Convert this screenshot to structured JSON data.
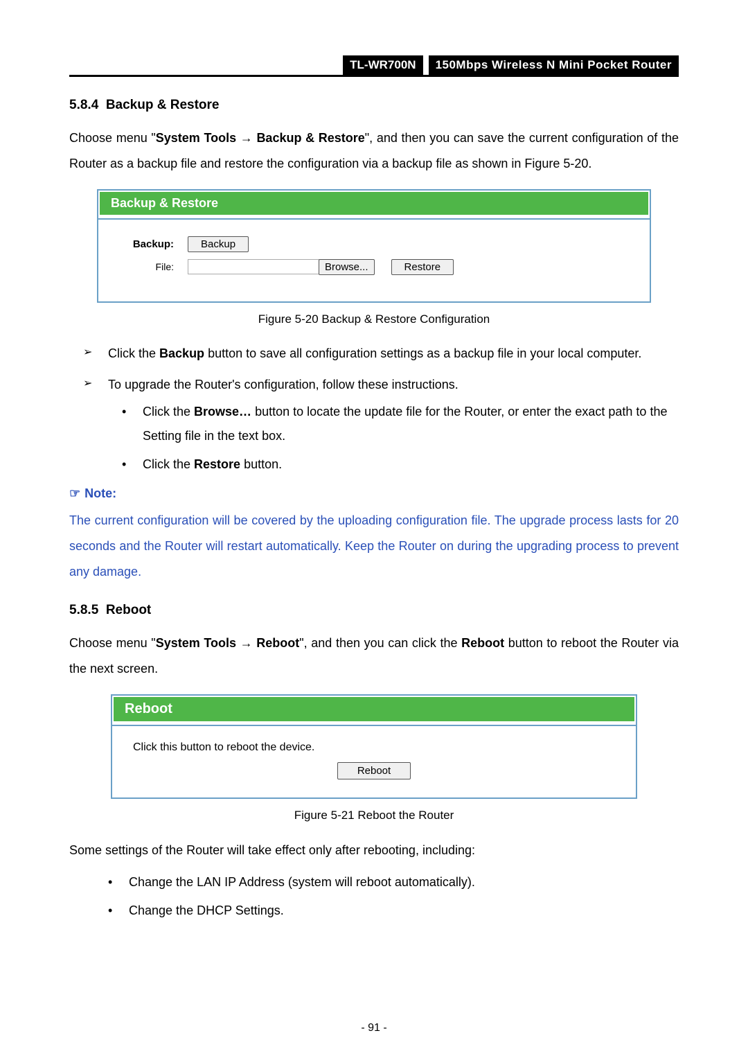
{
  "header": {
    "model": "TL-WR700N",
    "desc": "150Mbps Wireless N Mini Pocket Router"
  },
  "section584": {
    "num": "5.8.4",
    "title": "Backup & Restore",
    "intro_pre": "Choose menu \"",
    "intro_b1": "System Tools",
    "intro_arrow": " → ",
    "intro_b2": "Backup & Restore",
    "intro_post": "\", and then you can save the current configuration of the Router as a backup file and restore the configuration via a backup file as shown in Figure 5-20.",
    "panel": {
      "title": "Backup & Restore",
      "backup_label": "Backup:",
      "backup_btn": "Backup",
      "file_label": "File:",
      "browse_btn": "Browse...",
      "restore_btn": "Restore"
    },
    "figcap": "Figure 5-20   Backup & Restore Configuration",
    "bullet1_pre": "Click the ",
    "bullet1_b": "Backup",
    "bullet1_post": " button to save all configuration settings as a backup file in your local computer.",
    "bullet2": "To upgrade the Router's configuration, follow these instructions.",
    "sub1_pre": "Click the ",
    "sub1_b": "Browse…",
    "sub1_post": " button to locate the update file for the Router, or enter the exact path to the Setting file in the text box.",
    "sub2_pre": "Click the ",
    "sub2_b": "Restore",
    "sub2_post": " button."
  },
  "note": {
    "label": "Note:",
    "text": "The current configuration will be covered by the uploading configuration file. The upgrade process lasts for 20 seconds and the Router will restart automatically. Keep the Router on during the upgrading process to prevent any damage."
  },
  "section585": {
    "num": "5.8.5",
    "title": "Reboot",
    "intro_pre": "Choose menu \"",
    "intro_b1": "System Tools",
    "intro_arrow": " → ",
    "intro_b2": "Reboot",
    "intro_mid": "\", and then you can click the ",
    "intro_b3": "Reboot",
    "intro_post": " button to reboot the Router via the next screen.",
    "panel": {
      "title": "Reboot",
      "text": "Click this button to reboot the device.",
      "btn": "Reboot"
    },
    "figcap": "Figure 5-21 Reboot the Router",
    "after": "Some settings of the Router will take effect only after rebooting, including:",
    "sub1": "Change the LAN IP Address (system will reboot automatically).",
    "sub2": "Change the DHCP Settings."
  },
  "pagenum": "- 91 -"
}
